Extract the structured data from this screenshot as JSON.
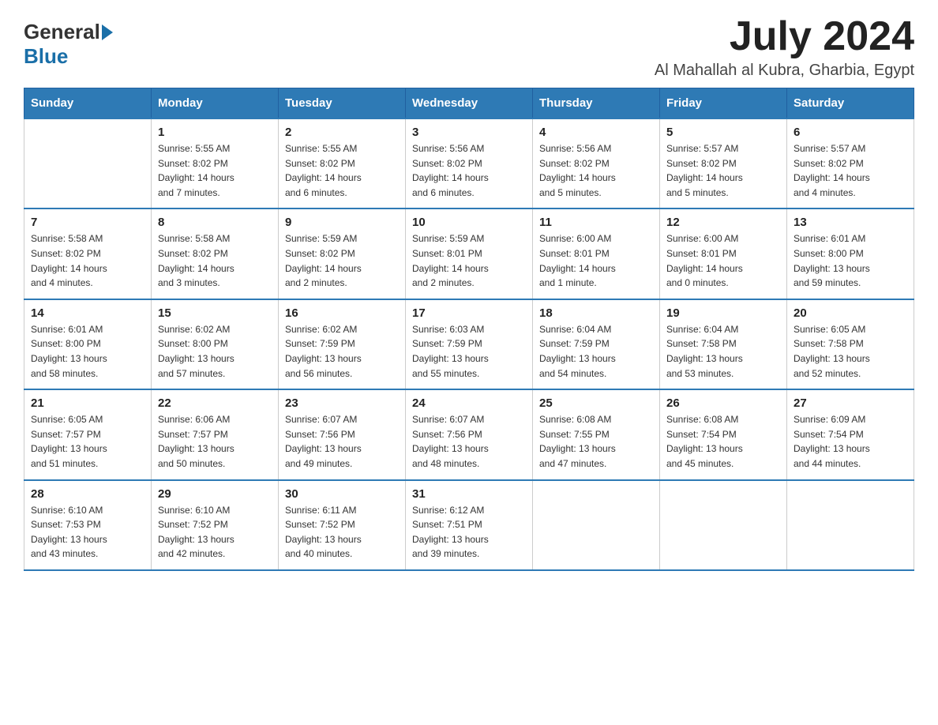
{
  "header": {
    "logo": {
      "general": "General",
      "blue": "Blue"
    },
    "title": "July 2024",
    "subtitle": "Al Mahallah al Kubra, Gharbia, Egypt"
  },
  "days_header": [
    "Sunday",
    "Monday",
    "Tuesday",
    "Wednesday",
    "Thursday",
    "Friday",
    "Saturday"
  ],
  "weeks": [
    [
      {
        "day": "",
        "info": ""
      },
      {
        "day": "1",
        "info": "Sunrise: 5:55 AM\nSunset: 8:02 PM\nDaylight: 14 hours\nand 7 minutes."
      },
      {
        "day": "2",
        "info": "Sunrise: 5:55 AM\nSunset: 8:02 PM\nDaylight: 14 hours\nand 6 minutes."
      },
      {
        "day": "3",
        "info": "Sunrise: 5:56 AM\nSunset: 8:02 PM\nDaylight: 14 hours\nand 6 minutes."
      },
      {
        "day": "4",
        "info": "Sunrise: 5:56 AM\nSunset: 8:02 PM\nDaylight: 14 hours\nand 5 minutes."
      },
      {
        "day": "5",
        "info": "Sunrise: 5:57 AM\nSunset: 8:02 PM\nDaylight: 14 hours\nand 5 minutes."
      },
      {
        "day": "6",
        "info": "Sunrise: 5:57 AM\nSunset: 8:02 PM\nDaylight: 14 hours\nand 4 minutes."
      }
    ],
    [
      {
        "day": "7",
        "info": "Sunrise: 5:58 AM\nSunset: 8:02 PM\nDaylight: 14 hours\nand 4 minutes."
      },
      {
        "day": "8",
        "info": "Sunrise: 5:58 AM\nSunset: 8:02 PM\nDaylight: 14 hours\nand 3 minutes."
      },
      {
        "day": "9",
        "info": "Sunrise: 5:59 AM\nSunset: 8:02 PM\nDaylight: 14 hours\nand 2 minutes."
      },
      {
        "day": "10",
        "info": "Sunrise: 5:59 AM\nSunset: 8:01 PM\nDaylight: 14 hours\nand 2 minutes."
      },
      {
        "day": "11",
        "info": "Sunrise: 6:00 AM\nSunset: 8:01 PM\nDaylight: 14 hours\nand 1 minute."
      },
      {
        "day": "12",
        "info": "Sunrise: 6:00 AM\nSunset: 8:01 PM\nDaylight: 14 hours\nand 0 minutes."
      },
      {
        "day": "13",
        "info": "Sunrise: 6:01 AM\nSunset: 8:00 PM\nDaylight: 13 hours\nand 59 minutes."
      }
    ],
    [
      {
        "day": "14",
        "info": "Sunrise: 6:01 AM\nSunset: 8:00 PM\nDaylight: 13 hours\nand 58 minutes."
      },
      {
        "day": "15",
        "info": "Sunrise: 6:02 AM\nSunset: 8:00 PM\nDaylight: 13 hours\nand 57 minutes."
      },
      {
        "day": "16",
        "info": "Sunrise: 6:02 AM\nSunset: 7:59 PM\nDaylight: 13 hours\nand 56 minutes."
      },
      {
        "day": "17",
        "info": "Sunrise: 6:03 AM\nSunset: 7:59 PM\nDaylight: 13 hours\nand 55 minutes."
      },
      {
        "day": "18",
        "info": "Sunrise: 6:04 AM\nSunset: 7:59 PM\nDaylight: 13 hours\nand 54 minutes."
      },
      {
        "day": "19",
        "info": "Sunrise: 6:04 AM\nSunset: 7:58 PM\nDaylight: 13 hours\nand 53 minutes."
      },
      {
        "day": "20",
        "info": "Sunrise: 6:05 AM\nSunset: 7:58 PM\nDaylight: 13 hours\nand 52 minutes."
      }
    ],
    [
      {
        "day": "21",
        "info": "Sunrise: 6:05 AM\nSunset: 7:57 PM\nDaylight: 13 hours\nand 51 minutes."
      },
      {
        "day": "22",
        "info": "Sunrise: 6:06 AM\nSunset: 7:57 PM\nDaylight: 13 hours\nand 50 minutes."
      },
      {
        "day": "23",
        "info": "Sunrise: 6:07 AM\nSunset: 7:56 PM\nDaylight: 13 hours\nand 49 minutes."
      },
      {
        "day": "24",
        "info": "Sunrise: 6:07 AM\nSunset: 7:56 PM\nDaylight: 13 hours\nand 48 minutes."
      },
      {
        "day": "25",
        "info": "Sunrise: 6:08 AM\nSunset: 7:55 PM\nDaylight: 13 hours\nand 47 minutes."
      },
      {
        "day": "26",
        "info": "Sunrise: 6:08 AM\nSunset: 7:54 PM\nDaylight: 13 hours\nand 45 minutes."
      },
      {
        "day": "27",
        "info": "Sunrise: 6:09 AM\nSunset: 7:54 PM\nDaylight: 13 hours\nand 44 minutes."
      }
    ],
    [
      {
        "day": "28",
        "info": "Sunrise: 6:10 AM\nSunset: 7:53 PM\nDaylight: 13 hours\nand 43 minutes."
      },
      {
        "day": "29",
        "info": "Sunrise: 6:10 AM\nSunset: 7:52 PM\nDaylight: 13 hours\nand 42 minutes."
      },
      {
        "day": "30",
        "info": "Sunrise: 6:11 AM\nSunset: 7:52 PM\nDaylight: 13 hours\nand 40 minutes."
      },
      {
        "day": "31",
        "info": "Sunrise: 6:12 AM\nSunset: 7:51 PM\nDaylight: 13 hours\nand 39 minutes."
      },
      {
        "day": "",
        "info": ""
      },
      {
        "day": "",
        "info": ""
      },
      {
        "day": "",
        "info": ""
      }
    ]
  ]
}
